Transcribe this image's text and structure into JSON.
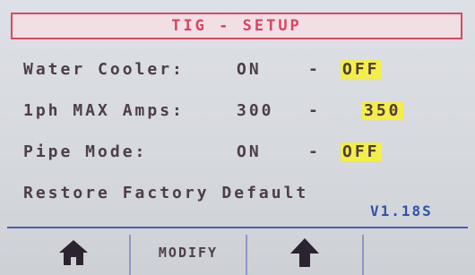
{
  "header": {
    "title": "TIG - SETUP"
  },
  "settings": {
    "water_cooler": {
      "label": "Water Cooler:",
      "option_a": "ON",
      "separator": "-",
      "option_b": "OFF",
      "selected": "OFF"
    },
    "max_amps": {
      "label": "1ph MAX Amps:",
      "option_a": "300",
      "separator": "-",
      "option_b": "350",
      "selected": "350"
    },
    "pipe_mode": {
      "label": "Pipe Mode:",
      "option_a": "ON",
      "separator": "-",
      "option_b": "OFF",
      "selected": "OFF"
    },
    "restore": {
      "label": "Restore Factory Default"
    }
  },
  "footer": {
    "version": "V1.18S"
  },
  "softkeys": {
    "home_icon": "home-icon",
    "modify_label": "MODIFY",
    "up_icon": "arrow-up-icon",
    "fourth": ""
  },
  "colors": {
    "text": "#4d3d4a",
    "title": "#d84460",
    "highlight": "#f3ee4a",
    "version": "#2f52a6",
    "rule": "#4a5fb0"
  }
}
